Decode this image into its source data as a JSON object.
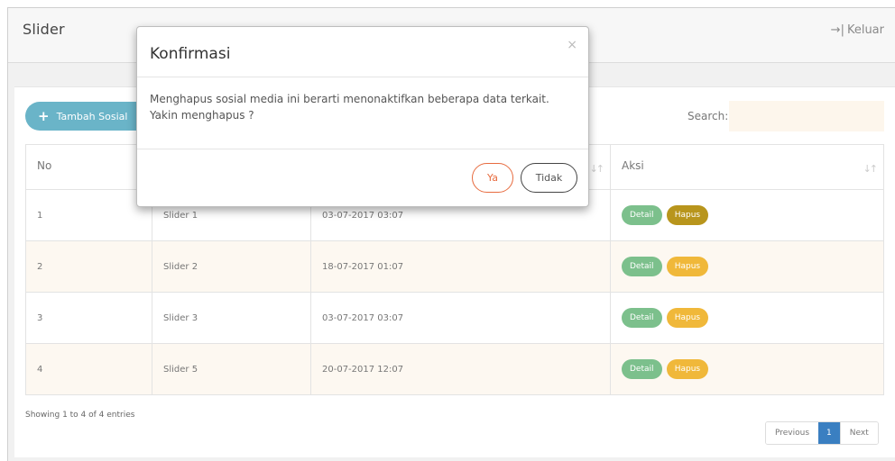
{
  "header": {
    "title": "Slider",
    "logout_label": "Keluar",
    "logout_icon": "exit-arrow-icon"
  },
  "toolbar": {
    "add_label": "Tambah Sosial",
    "search_label": "Search:",
    "search_value": ""
  },
  "table": {
    "columns": [
      "No",
      "",
      "",
      "Aksi"
    ],
    "rows": [
      {
        "no": "1",
        "name": "Slider 1",
        "date": "03-07-2017 03:07",
        "detail": "Detail",
        "delete": "Hapus"
      },
      {
        "no": "2",
        "name": "Slider 2",
        "date": "18-07-2017 01:07",
        "detail": "Detail",
        "delete": "Hapus"
      },
      {
        "no": "3",
        "name": "Slider 3",
        "date": "03-07-2017 03:07",
        "detail": "Detail",
        "delete": "Hapus"
      },
      {
        "no": "4",
        "name": "Slider 5",
        "date": "20-07-2017 12:07",
        "detail": "Detail",
        "delete": "Hapus"
      }
    ]
  },
  "footer": {
    "info": "Showing 1 to 4 of 4 entries",
    "prev_label": "Previous",
    "current_page": "1",
    "next_label": "Next"
  },
  "modal": {
    "title": "Konfirmasi",
    "close_glyph": "×",
    "message_line1": "Menghapus sosial media ini berarti menonaktifkan beberapa data terkait.",
    "message_line2": "Yakin menghapus ?",
    "confirm_label": "Ya",
    "cancel_label": "Tidak"
  },
  "colors": {
    "add_button": "#6ab4c8",
    "detail_badge": "#7cc08c",
    "hapus_badge": "#f0b83a",
    "hapus_badge_hover": "#b8951c",
    "confirm_border": "#e76b3f",
    "pager_active": "#3a7fc1"
  }
}
